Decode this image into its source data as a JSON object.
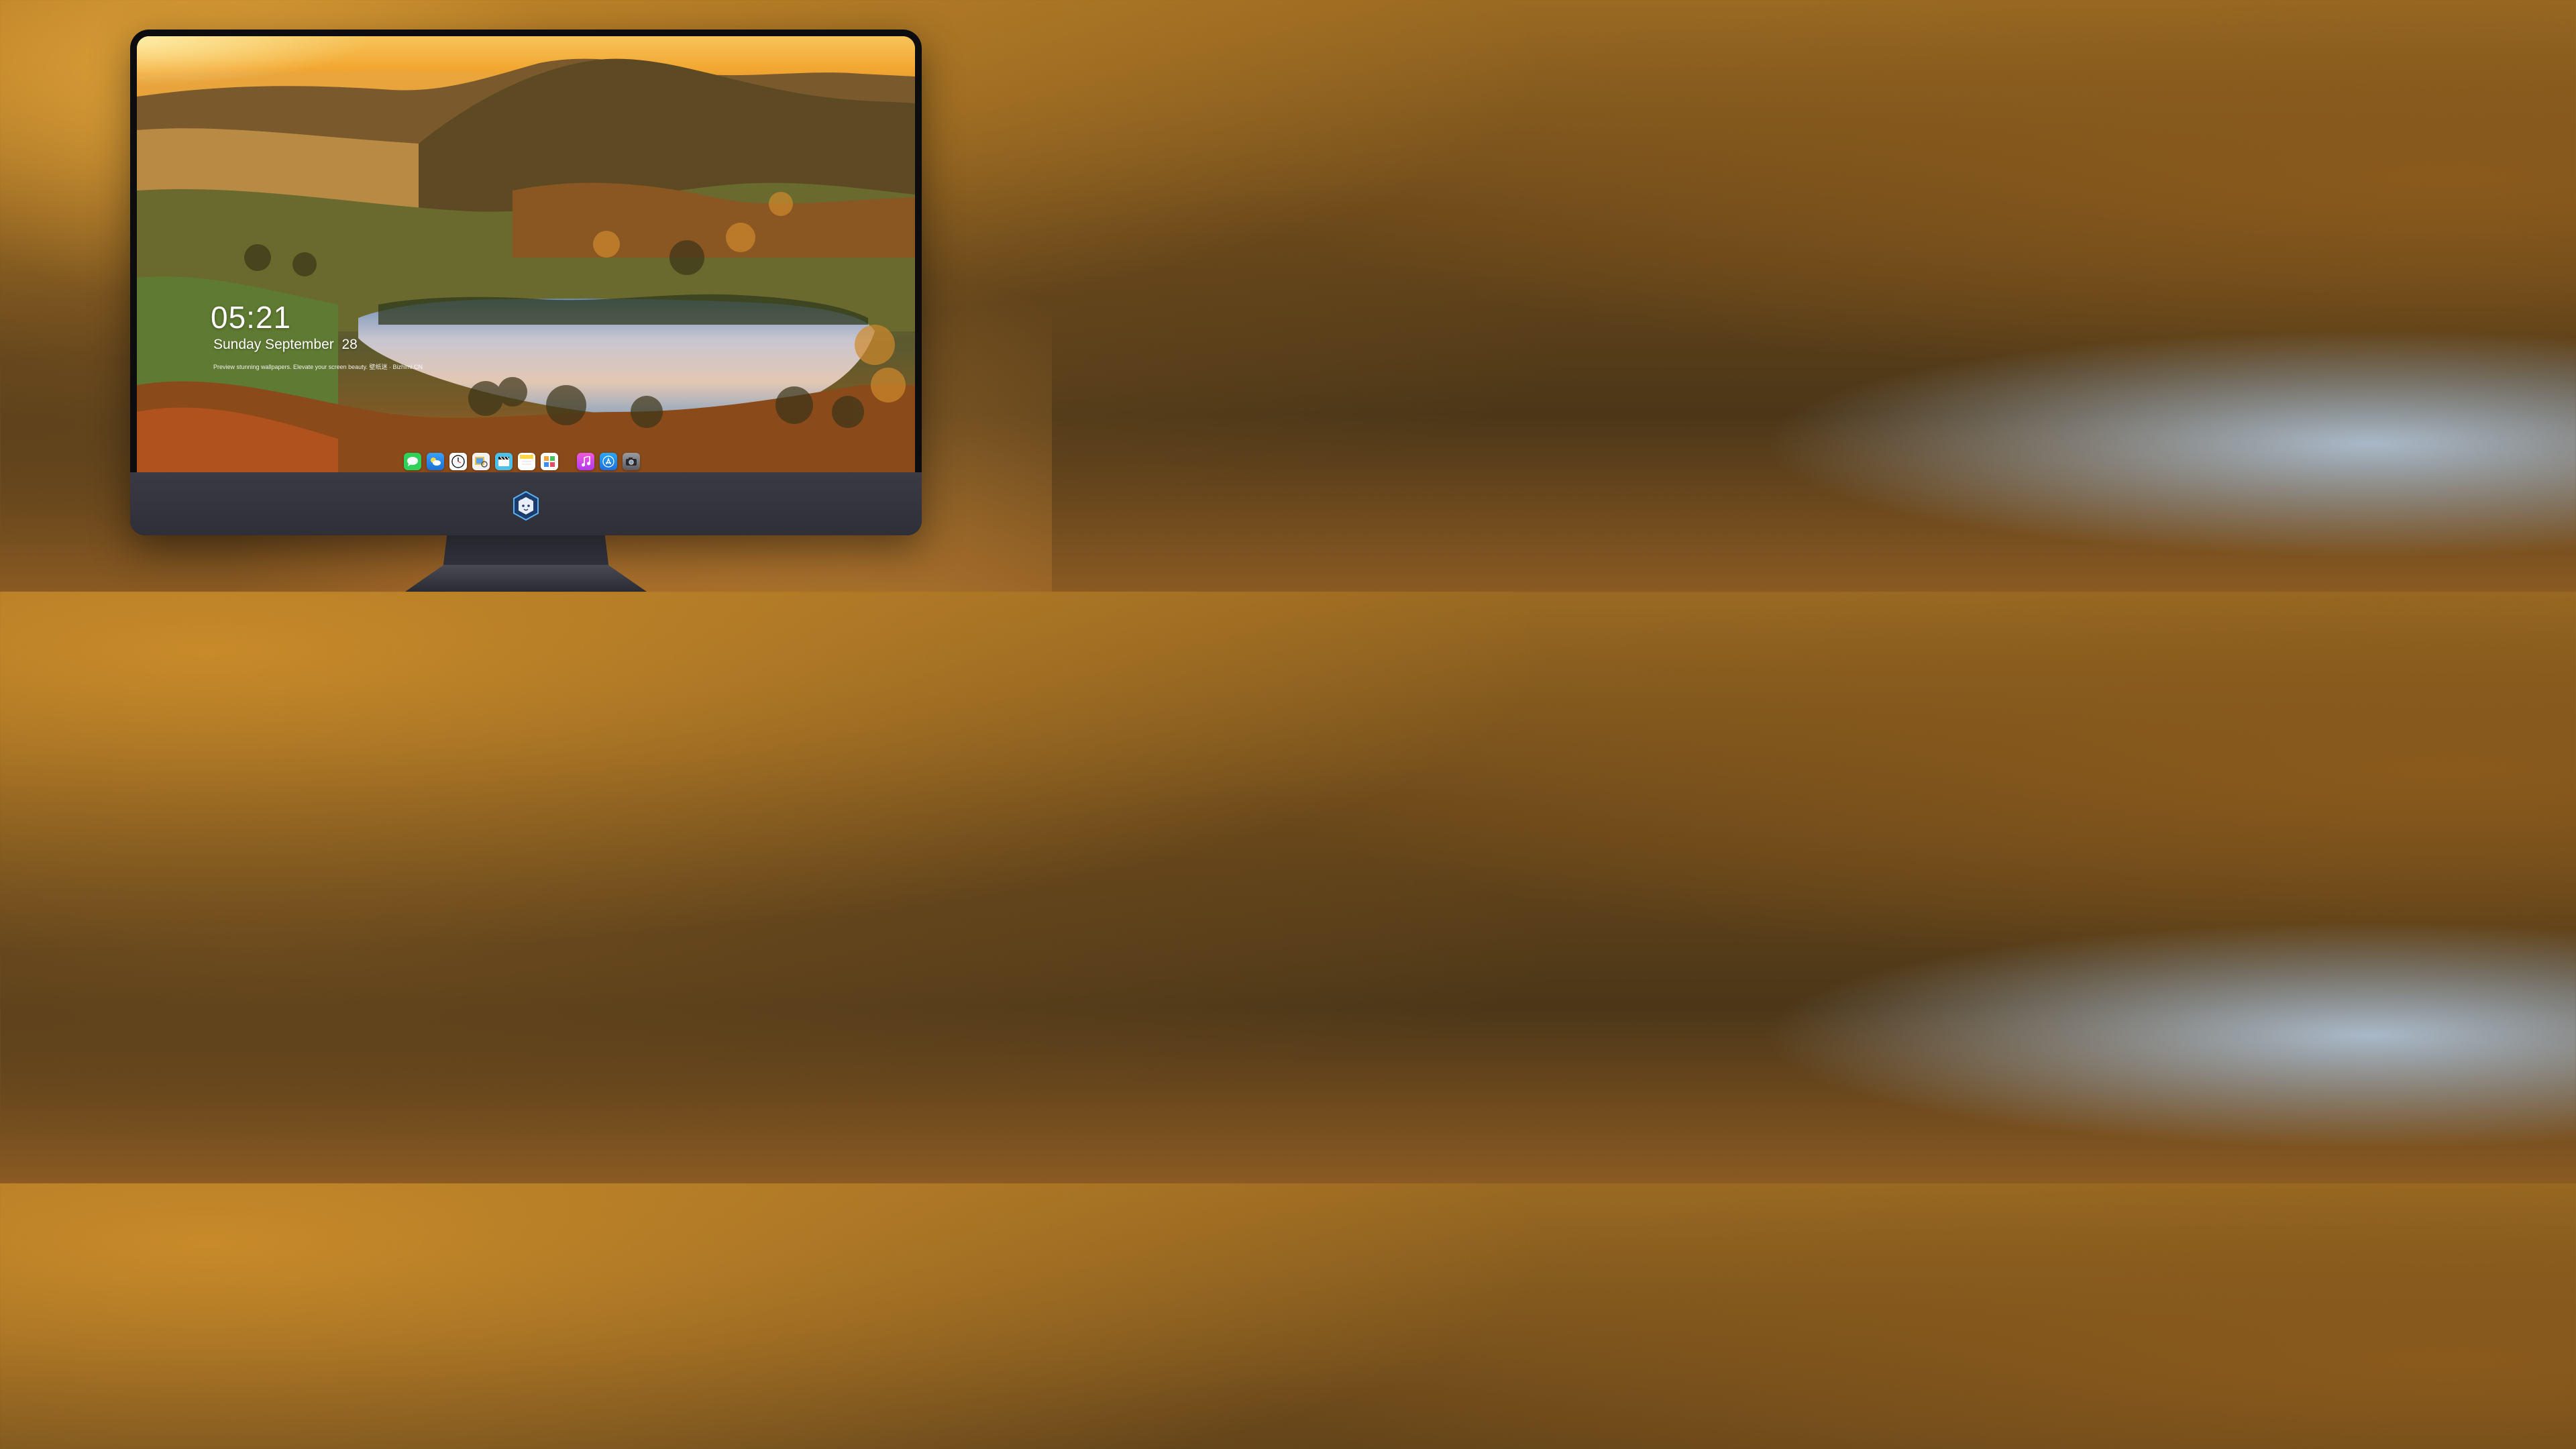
{
  "lockscreen": {
    "time": "05:21",
    "date": "Sunday September  28",
    "tagline": "Preview stunning wallpapers. Elevate your screen beauty. 壁纸迷 · Bizhimi.CN"
  },
  "dock": {
    "items": [
      {
        "name": "Messages",
        "icon": "message-bubble",
        "color": "#2fd158"
      },
      {
        "name": "Weather",
        "icon": "cloud",
        "color": "#2f8cf0"
      },
      {
        "name": "Clock",
        "icon": "clock",
        "color": "#ffffff"
      },
      {
        "name": "Preview",
        "icon": "image-viewer",
        "color": "#e8c24a"
      },
      {
        "name": "Clips",
        "icon": "clapperboard",
        "color": "#4bc0e8"
      },
      {
        "name": "Notes",
        "icon": "notepad",
        "color": "#ffd54a"
      },
      {
        "name": "Photos",
        "icon": "photos-grid",
        "color": "#f0f0f0"
      },
      {
        "name": "Music",
        "icon": "music-note",
        "color": "#e84ad0"
      },
      {
        "name": "App Store",
        "icon": "app-store",
        "color": "#1e8ef0"
      },
      {
        "name": "Camera",
        "icon": "camera",
        "color": "#8a8a90"
      }
    ]
  },
  "branding": {
    "logo_icon": "fox-mascot-logo"
  },
  "colors": {
    "monitor_bezel": "#0d0d10",
    "monitor_chin": "#2f2f38",
    "text": "#ffffff"
  }
}
